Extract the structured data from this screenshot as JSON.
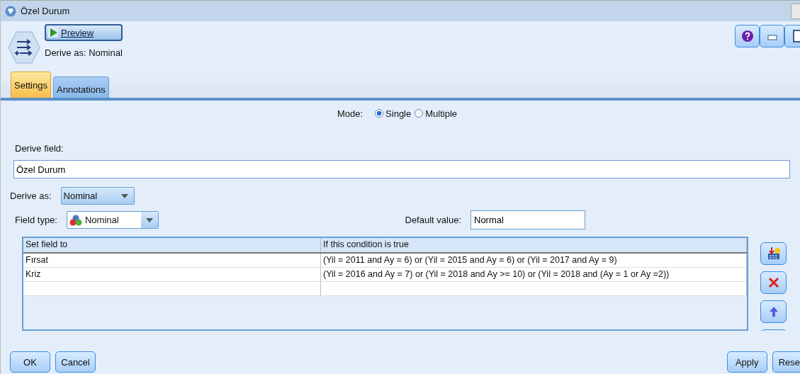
{
  "window": {
    "title": "Özel Durum"
  },
  "header": {
    "preview_button": "Preview",
    "subtitle": "Derive as: Nominal"
  },
  "tabs": [
    {
      "label": "Settings",
      "selected": true
    },
    {
      "label": "Annotations",
      "selected": false
    }
  ],
  "mode": {
    "label": "Mode:",
    "options": [
      {
        "label": "Single",
        "selected": true
      },
      {
        "label": "Multiple",
        "selected": false
      }
    ]
  },
  "derive_field": {
    "label": "Derive field:",
    "value": "Özel Durum"
  },
  "derive_as": {
    "label": "Derive as:",
    "value": "Nominal"
  },
  "field_type": {
    "label": "Field type:",
    "value": "Nominal"
  },
  "default_value": {
    "label": "Default value:",
    "value": "Normal"
  },
  "table": {
    "columns": [
      "Set field to",
      "If this condition is true"
    ],
    "rows": [
      [
        "Fırsat",
        "(Yil = 2011 and  Ay = 6) or (Yil = 2015 and  Ay = 6) or (Yil = 2017 and  Ay = 9)"
      ],
      [
        "Kriz",
        "(Yil = 2016 and Ay = 7) or (Yil = 2018 and Ay >= 10) or (Yil = 2018 and (Ay = 1 or Ay =2))"
      ]
    ]
  },
  "footer": {
    "left_buttons": [
      "OK",
      "Cancel"
    ],
    "right_buttons": [
      "Apply",
      "Rese"
    ]
  }
}
